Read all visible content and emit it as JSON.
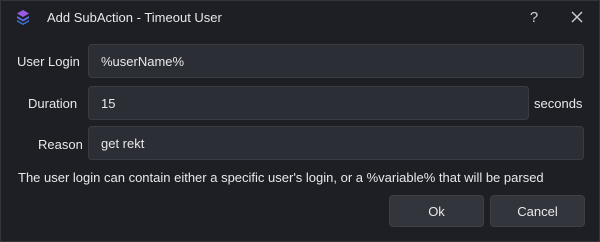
{
  "window": {
    "title": "Add SubAction - Timeout User",
    "help_label": "?",
    "close_label": "✕"
  },
  "form": {
    "user_login": {
      "label": "User Login",
      "value": "%userName%"
    },
    "duration": {
      "label": "Duration",
      "value": "15",
      "suffix": "seconds"
    },
    "reason": {
      "label": "Reason",
      "value": "get rekt"
    },
    "hint": "The user login can contain either a specific user's login, or a %variable% that will be parsed"
  },
  "buttons": {
    "ok": "Ok",
    "cancel": "Cancel"
  },
  "colors": {
    "background": "#1e1f24",
    "field": "#2c2e35",
    "button": "#33353d",
    "icon_blue": "#3f7be8",
    "icon_purple": "#9b59e6"
  }
}
